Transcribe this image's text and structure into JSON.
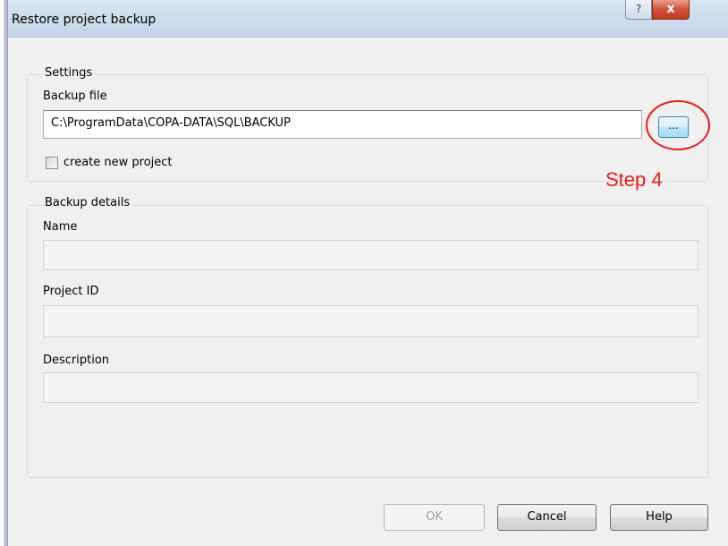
{
  "window": {
    "title": "Restore project backup",
    "help_glyph": "?",
    "close_glyph": "x"
  },
  "settings": {
    "legend": "Settings",
    "backup_file_label": "Backup file",
    "backup_file_value": "C:\\ProgramData\\COPA-DATA\\SQL\\BACKUP",
    "browse_label": "...",
    "create_new_project_label": "create new project",
    "create_new_project_checked": false
  },
  "annotation": {
    "step_label": "Step 4",
    "color": "#e81b1b"
  },
  "details": {
    "legend": "Backup details",
    "name_label": "Name",
    "name_value": "",
    "project_id_label": "Project ID",
    "project_id_value": "",
    "description_label": "Description",
    "description_value": ""
  },
  "buttons": {
    "ok": "OK",
    "cancel": "Cancel",
    "help": "Help"
  }
}
